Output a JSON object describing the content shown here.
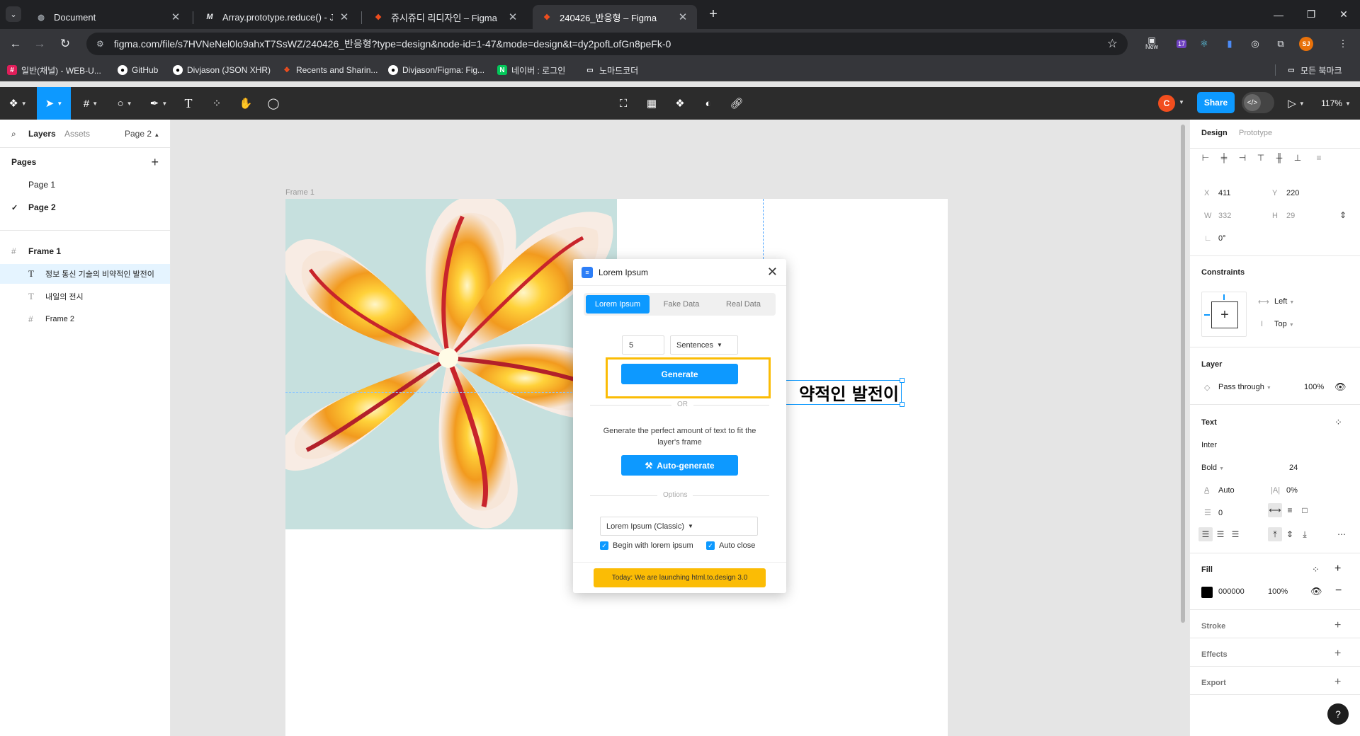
{
  "browser": {
    "tabs": [
      {
        "title": "Document",
        "favicon": "globe-icon"
      },
      {
        "title": "Array.prototype.reduce() - Java",
        "favicon": "mdn-icon"
      },
      {
        "title": "쥬시쥬디 리디자인 – Figma",
        "favicon": "figma-icon"
      },
      {
        "title": "240426_반응형 – Figma",
        "favicon": "figma-icon"
      }
    ],
    "site_info": "⚙",
    "url": "figma.com/file/s7HVNeNel0lo9ahxT7SsWZ/240426_반응형?type=design&node-id=1-47&mode=design&t=dy2pofLofGn8peFk-0",
    "extensions": {
      "new_label": "New",
      "badge_count": "17",
      "profile_initials": "SJ"
    }
  },
  "bookmarks": {
    "items": [
      {
        "label": "일반(채널) - WEB-U..."
      },
      {
        "label": "GitHub"
      },
      {
        "label": "Divjason (JSON XHR)"
      },
      {
        "label": "Recents and Sharin..."
      },
      {
        "label": "Divjason/Figma: Fig..."
      },
      {
        "label": "네이버 : 로그인"
      },
      {
        "label": "노마드코더"
      }
    ],
    "all_bookmarks": "모든 북마크"
  },
  "figma_toolbar": {
    "avatar_initial": "C",
    "share_label": "Share",
    "zoom_label": "117%"
  },
  "left_panel": {
    "tabs": {
      "layers": "Layers",
      "assets": "Assets",
      "page_selector": "Page 2"
    },
    "pages_heading": "Pages",
    "pages": [
      {
        "name": "Page 1",
        "selected": false
      },
      {
        "name": "Page 2",
        "selected": true
      }
    ],
    "layers": [
      {
        "name": "Frame 1",
        "type": "frame",
        "indent": 0
      },
      {
        "name": "정보 통신 기술의 비약적인 발전이",
        "type": "text",
        "indent": 1,
        "selected": true
      },
      {
        "name": "내일의 전시",
        "type": "text",
        "indent": 1
      },
      {
        "name": "Frame 2",
        "type": "frame",
        "indent": 1
      }
    ]
  },
  "canvas": {
    "frame_label": "Frame 1",
    "selected_text": "약적인 발전이"
  },
  "plugin": {
    "title": "Lorem Ipsum",
    "tabs": [
      "Lorem Ipsum",
      "Fake Data",
      "Real Data"
    ],
    "active_tab": "Lorem Ipsum",
    "count_value": "5",
    "unit_value": "Sentences",
    "generate_label": "Generate",
    "or_label": "OR",
    "auto_description": "Generate the perfect amount of text to fit the layer's frame",
    "auto_generate_label": "Auto-generate",
    "options_label": "Options",
    "style_value": "Lorem Ipsum (Classic)",
    "begin_with_lorem_label": "Begin with lorem ipsum",
    "begin_with_lorem_checked": true,
    "auto_close_label": "Auto close",
    "auto_close_checked": true,
    "banner": "Today: We are launching html.to.design 3.0"
  },
  "right_panel": {
    "tabs": {
      "design": "Design",
      "prototype": "Prototype"
    },
    "position": {
      "x_label": "X",
      "x": "411",
      "y_label": "Y",
      "y": "220",
      "w_label": "W",
      "w": "332",
      "h_label": "H",
      "h": "29",
      "rotation": "0°"
    },
    "constraints": {
      "heading": "Constraints",
      "horizontal": "Left",
      "vertical": "Top"
    },
    "layer": {
      "heading": "Layer",
      "blend": "Pass through",
      "opacity": "100%"
    },
    "text": {
      "heading": "Text",
      "font": "Inter",
      "weight": "Bold",
      "size": "24",
      "line_height": "Auto",
      "letter_spacing": "0%",
      "paragraph_spacing": "0"
    },
    "fill": {
      "heading": "Fill",
      "hex": "000000",
      "opacity": "100%",
      "color": "#000000"
    },
    "stroke_heading": "Stroke",
    "effects_heading": "Effects",
    "export_heading": "Export",
    "help_label": "?"
  },
  "colors": {
    "accent": "#0d99ff",
    "highlight": "#fbbc05",
    "figma_bar": "#2c2c2c"
  }
}
